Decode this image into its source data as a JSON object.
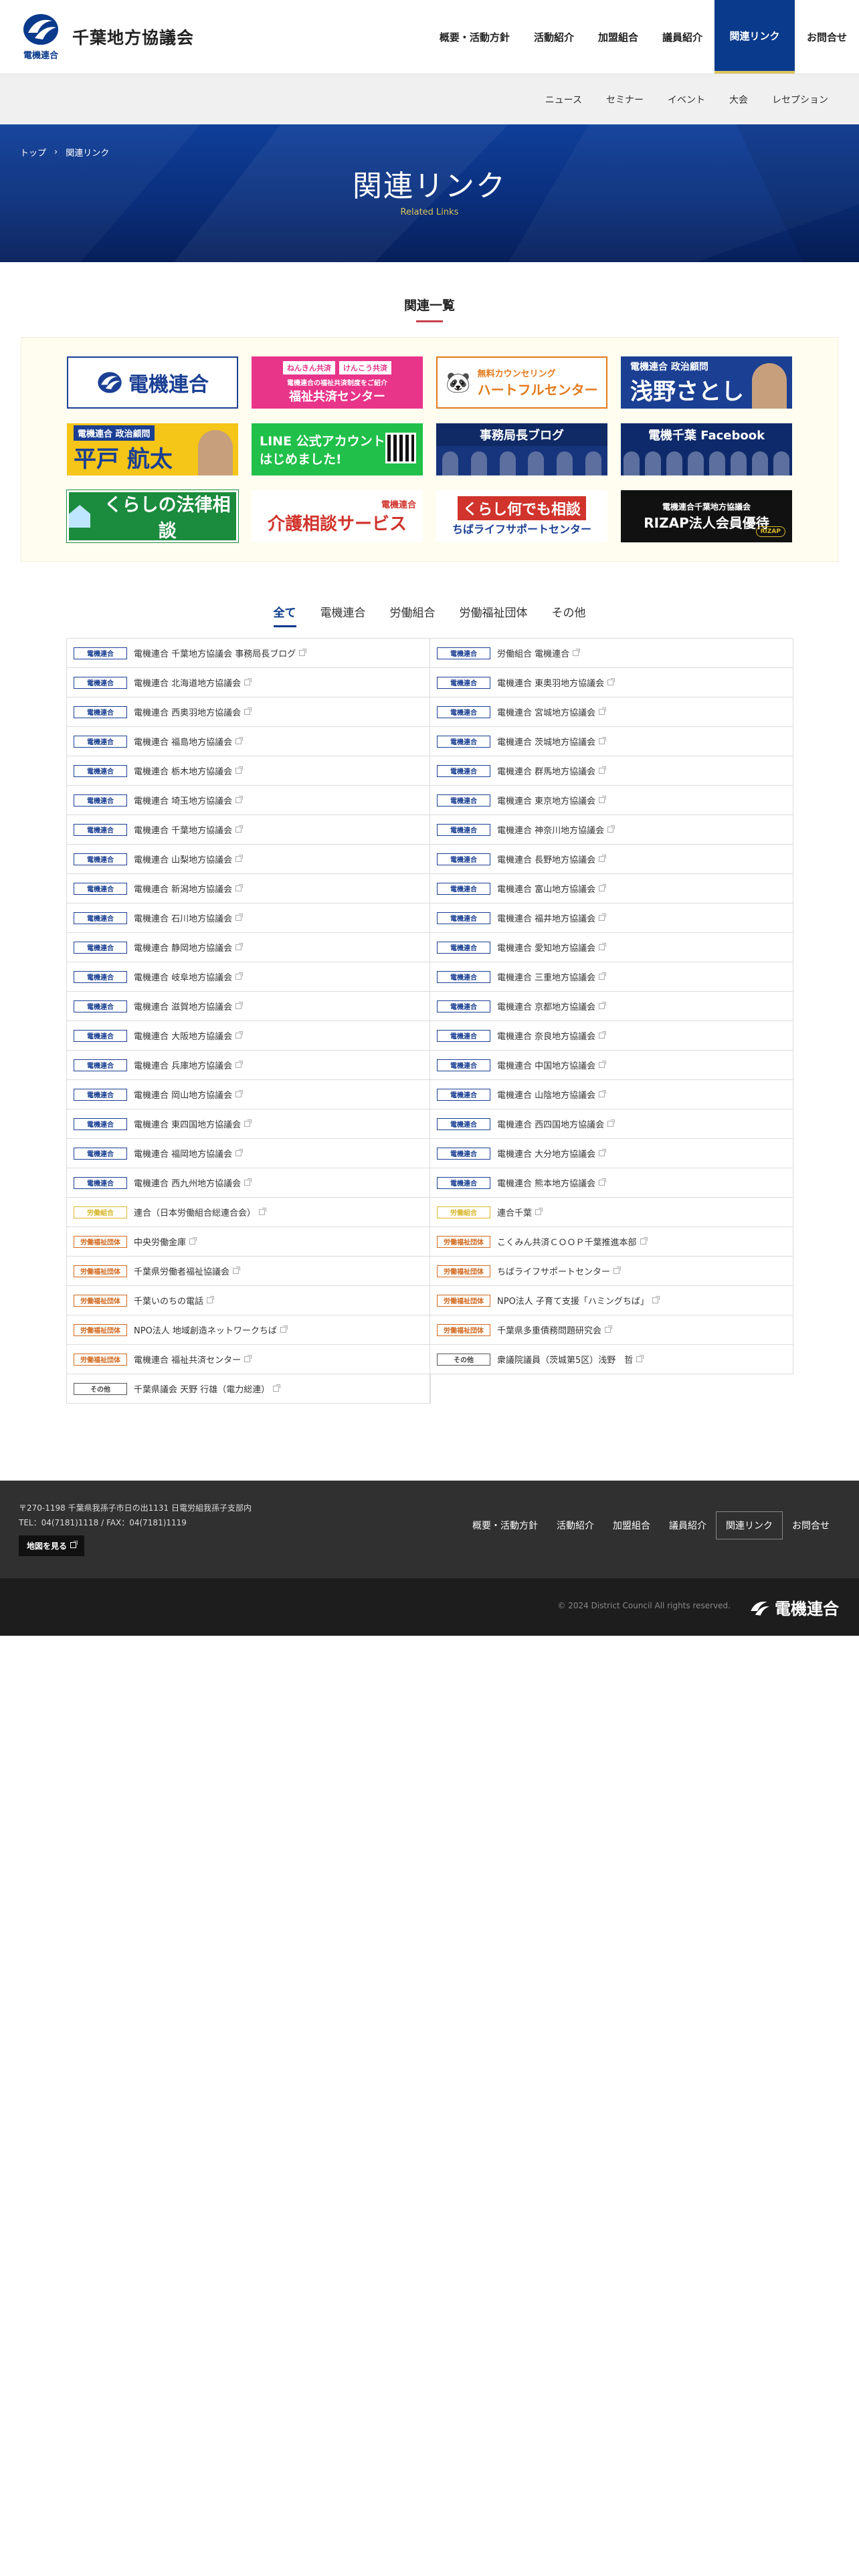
{
  "site": {
    "logo_sub": "電機連合",
    "name": "千葉地方協議会"
  },
  "gnav": [
    {
      "label": "概要・活動方針",
      "active": false
    },
    {
      "label": "活動紹介",
      "active": false
    },
    {
      "label": "加盟組合",
      "active": false
    },
    {
      "label": "議員紹介",
      "active": false
    },
    {
      "label": "関連リンク",
      "active": true
    },
    {
      "label": "お問合せ",
      "active": false
    }
  ],
  "subnav": [
    "ニュース",
    "セミナー",
    "イベント",
    "大会",
    "レセプション"
  ],
  "breadcrumb": {
    "home": "トップ",
    "current": "関連リンク"
  },
  "hero": {
    "title": "関連リンク",
    "subtitle": "Related Links"
  },
  "section_title": "関連一覧",
  "banners": {
    "b1": "電機連合",
    "b2_chip1": "ねんきん共済",
    "b2_chip2": "けんこう共済",
    "b2_small": "電機連合の福祉共済制度をご紹介",
    "b2": "福祉共済センター",
    "b3_top": "無料カウンセリング",
    "b3": "ハートフルセンター",
    "b4_top": "電機連合 政治顧問",
    "b4": "浅野さとし",
    "b5_top": "電機連合 政治顧問",
    "b5": "平戸 航太",
    "b6_l1": "LINE 公式アカウント",
    "b6_l2": "はじめました!",
    "b7": "事務局長ブログ",
    "b8": "電機千葉 Facebook",
    "b9": "くらしの法律相談",
    "b10_top": "電機連合",
    "b10": "介護相談サービス",
    "b11": "くらし何でも相談",
    "b11_sub": "ちばライフサポートセンター",
    "b12_small": "電機連合千葉地方協議会",
    "b12": "RIZAP法人会員優待",
    "b12_logo": "RIZAP"
  },
  "tabs": [
    {
      "label": "全て",
      "active": true
    },
    {
      "label": "電機連合",
      "active": false
    },
    {
      "label": "労働組合",
      "active": false
    },
    {
      "label": "労働福祉団体",
      "active": false
    },
    {
      "label": "その他",
      "active": false
    }
  ],
  "links": [
    {
      "tag": "電機連合",
      "type": "denki",
      "text": "電機連合 千葉地方協議会 事務局長ブログ"
    },
    {
      "tag": "電機連合",
      "type": "denki",
      "text": "労働組合 電機連合"
    },
    {
      "tag": "電機連合",
      "type": "denki",
      "text": "電機連合 北海道地方協議会"
    },
    {
      "tag": "電機連合",
      "type": "denki",
      "text": "電機連合 東奥羽地方協議会"
    },
    {
      "tag": "電機連合",
      "type": "denki",
      "text": "電機連合 西奥羽地方協議会"
    },
    {
      "tag": "電機連合",
      "type": "denki",
      "text": "電機連合 宮城地方協議会"
    },
    {
      "tag": "電機連合",
      "type": "denki",
      "text": "電機連合 福島地方協議会"
    },
    {
      "tag": "電機連合",
      "type": "denki",
      "text": "電機連合 茨城地方協議会"
    },
    {
      "tag": "電機連合",
      "type": "denki",
      "text": "電機連合 栃木地方協議会"
    },
    {
      "tag": "電機連合",
      "type": "denki",
      "text": "電機連合 群馬地方協議会"
    },
    {
      "tag": "電機連合",
      "type": "denki",
      "text": "電機連合 埼玉地方協議会"
    },
    {
      "tag": "電機連合",
      "type": "denki",
      "text": "電機連合 東京地方協議会"
    },
    {
      "tag": "電機連合",
      "type": "denki",
      "text": "電機連合 千葉地方協議会"
    },
    {
      "tag": "電機連合",
      "type": "denki",
      "text": "電機連合 神奈川地方協議会"
    },
    {
      "tag": "電機連合",
      "type": "denki",
      "text": "電機連合 山梨地方協議会"
    },
    {
      "tag": "電機連合",
      "type": "denki",
      "text": "電機連合 長野地方協議会"
    },
    {
      "tag": "電機連合",
      "type": "denki",
      "text": "電機連合 新潟地方協議会"
    },
    {
      "tag": "電機連合",
      "type": "denki",
      "text": "電機連合 富山地方協議会"
    },
    {
      "tag": "電機連合",
      "type": "denki",
      "text": "電機連合 石川地方協議会"
    },
    {
      "tag": "電機連合",
      "type": "denki",
      "text": "電機連合 福井地方協議会"
    },
    {
      "tag": "電機連合",
      "type": "denki",
      "text": "電機連合 静岡地方協議会"
    },
    {
      "tag": "電機連合",
      "type": "denki",
      "text": "電機連合 愛知地方協議会"
    },
    {
      "tag": "電機連合",
      "type": "denki",
      "text": "電機連合 岐阜地方協議会"
    },
    {
      "tag": "電機連合",
      "type": "denki",
      "text": "電機連合 三重地方協議会"
    },
    {
      "tag": "電機連合",
      "type": "denki",
      "text": "電機連合 滋賀地方協議会"
    },
    {
      "tag": "電機連合",
      "type": "denki",
      "text": "電機連合 京都地方協議会"
    },
    {
      "tag": "電機連合",
      "type": "denki",
      "text": "電機連合 大阪地方協議会"
    },
    {
      "tag": "電機連合",
      "type": "denki",
      "text": "電機連合 奈良地方協議会"
    },
    {
      "tag": "電機連合",
      "type": "denki",
      "text": "電機連合 兵庫地方協議会"
    },
    {
      "tag": "電機連合",
      "type": "denki",
      "text": "電機連合 中国地方協議会"
    },
    {
      "tag": "電機連合",
      "type": "denki",
      "text": "電機連合 岡山地方協議会"
    },
    {
      "tag": "電機連合",
      "type": "denki",
      "text": "電機連合 山陰地方協議会"
    },
    {
      "tag": "電機連合",
      "type": "denki",
      "text": "電機連合 東四国地方協議会"
    },
    {
      "tag": "電機連合",
      "type": "denki",
      "text": "電機連合 西四国地方協議会"
    },
    {
      "tag": "電機連合",
      "type": "denki",
      "text": "電機連合 福岡地方協議会"
    },
    {
      "tag": "電機連合",
      "type": "denki",
      "text": "電機連合 大分地方協議会"
    },
    {
      "tag": "電機連合",
      "type": "denki",
      "text": "電機連合 西九州地方協議会"
    },
    {
      "tag": "電機連合",
      "type": "denki",
      "text": "電機連合 熊本地方協議会"
    },
    {
      "tag": "労働組合",
      "type": "union",
      "text": "連合（日本労働組合総連合会）"
    },
    {
      "tag": "労働組合",
      "type": "union",
      "text": "連合千葉"
    },
    {
      "tag": "労働福祉団体",
      "type": "welfare",
      "text": "中央労働金庫"
    },
    {
      "tag": "労働福祉団体",
      "type": "welfare",
      "text": "こくみん共済ＣＯＯＰ千葉推進本部"
    },
    {
      "tag": "労働福祉団体",
      "type": "welfare",
      "text": "千葉県労働者福祉協議会"
    },
    {
      "tag": "労働福祉団体",
      "type": "welfare",
      "text": "ちばライフサポートセンター"
    },
    {
      "tag": "労働福祉団体",
      "type": "welfare",
      "text": "千葉いのちの電話"
    },
    {
      "tag": "労働福祉団体",
      "type": "welfare",
      "text": "NPO法人 子育て支援「ハミングちば」"
    },
    {
      "tag": "労働福祉団体",
      "type": "welfare",
      "text": "NPO法人 地域創造ネットワークちば"
    },
    {
      "tag": "労働福祉団体",
      "type": "welfare",
      "text": "千葉県多重債務問題研究会"
    },
    {
      "tag": "労働福祉団体",
      "type": "welfare",
      "text": "電機連合 福祉共済センター"
    },
    {
      "tag": "その他",
      "type": "other",
      "text": "衆議院議員（茨城第5区）浅野　哲"
    },
    {
      "tag": "その他",
      "type": "other",
      "text": "千葉県議会 天野 行雄（電力総連）"
    }
  ],
  "footer": {
    "address": "〒270-1198 千葉県我孫子市日の出1131 日電労組我孫子支部内",
    "tel": "TEL：04(7181)1118 / FAX：04(7181)1119",
    "map_button": "地図を見る",
    "nav": [
      {
        "label": "概要・活動方針",
        "active": false
      },
      {
        "label": "活動紹介",
        "active": false
      },
      {
        "label": "加盟組合",
        "active": false
      },
      {
        "label": "議員紹介",
        "active": false
      },
      {
        "label": "関連リンク",
        "active": true
      },
      {
        "label": "お問合せ",
        "active": false
      }
    ],
    "copyright": "© 2024 District Council All rights reserved.",
    "logo_text": "電機連合"
  },
  "colors": {
    "brand": "#0a3a8c",
    "accent_gold": "#d8c45a",
    "accent_red": "#c9414b"
  }
}
